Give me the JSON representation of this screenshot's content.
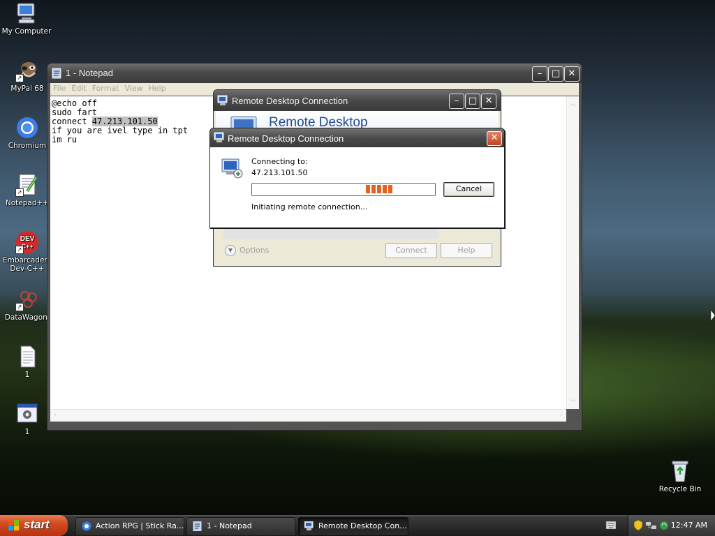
{
  "desktop": {
    "icons": [
      {
        "label": "My Computer",
        "icon": "computer-icon"
      },
      {
        "label": "MyPal 68",
        "icon": "mypal-icon"
      },
      {
        "label": "Chromium",
        "icon": "chromium-icon"
      },
      {
        "label": "Notepad++",
        "icon": "notepadpp-icon"
      },
      {
        "label": "Embarcadero Dev-C++",
        "label_line1": "Embarcadero",
        "label_line2": "Dev-C++",
        "icon": "devcpp-icon",
        "badge": "DEV\nC++"
      },
      {
        "label": "DataWagon.",
        "icon": "datawagon-icon"
      },
      {
        "label": "1",
        "icon": "text-file-icon"
      },
      {
        "label": "1",
        "icon": "batch-file-icon"
      },
      {
        "label": "Recycle Bin",
        "icon": "recycle-bin-icon"
      }
    ]
  },
  "notepad": {
    "title": "1 - Notepad",
    "menu": [
      "File",
      "Edit",
      "Format",
      "View",
      "Help"
    ],
    "lines": [
      {
        "text": "@echo off"
      },
      {
        "text": "sudo fart"
      },
      {
        "prefix": "connect ",
        "selected": "47.213.101.50"
      },
      {
        "text": "if you are ivel type in tpt"
      },
      {
        "text": "im ru"
      }
    ]
  },
  "rdc_window": {
    "title": "Remote Desktop Connection",
    "banner": "Remote Desktop",
    "options_label": "Options",
    "connect_label": "Connect",
    "help_label": "Help"
  },
  "rdc_dialog": {
    "title": "Remote Desktop Connection",
    "connecting_label": "Connecting to:",
    "address": "47.213.101.50",
    "cancel_label": "Cancel",
    "status": "Initiating remote connection...",
    "progress_color": "#e0641e"
  },
  "taskbar": {
    "start_label": "start",
    "tasks": [
      {
        "label": "Action RPG | Stick Ra...",
        "icon": "chromium-icon"
      },
      {
        "label": "1 - Notepad",
        "icon": "notepad-icon"
      },
      {
        "label": "Remote Desktop Con...",
        "icon": "rdc-icon",
        "active": true
      }
    ],
    "clock": "12:47 AM"
  },
  "colors": {
    "start_button": "#d44a20",
    "titlebar": "#4a4a4a",
    "close_red": "#c2421d",
    "banner_text": "#1f4a8c"
  }
}
